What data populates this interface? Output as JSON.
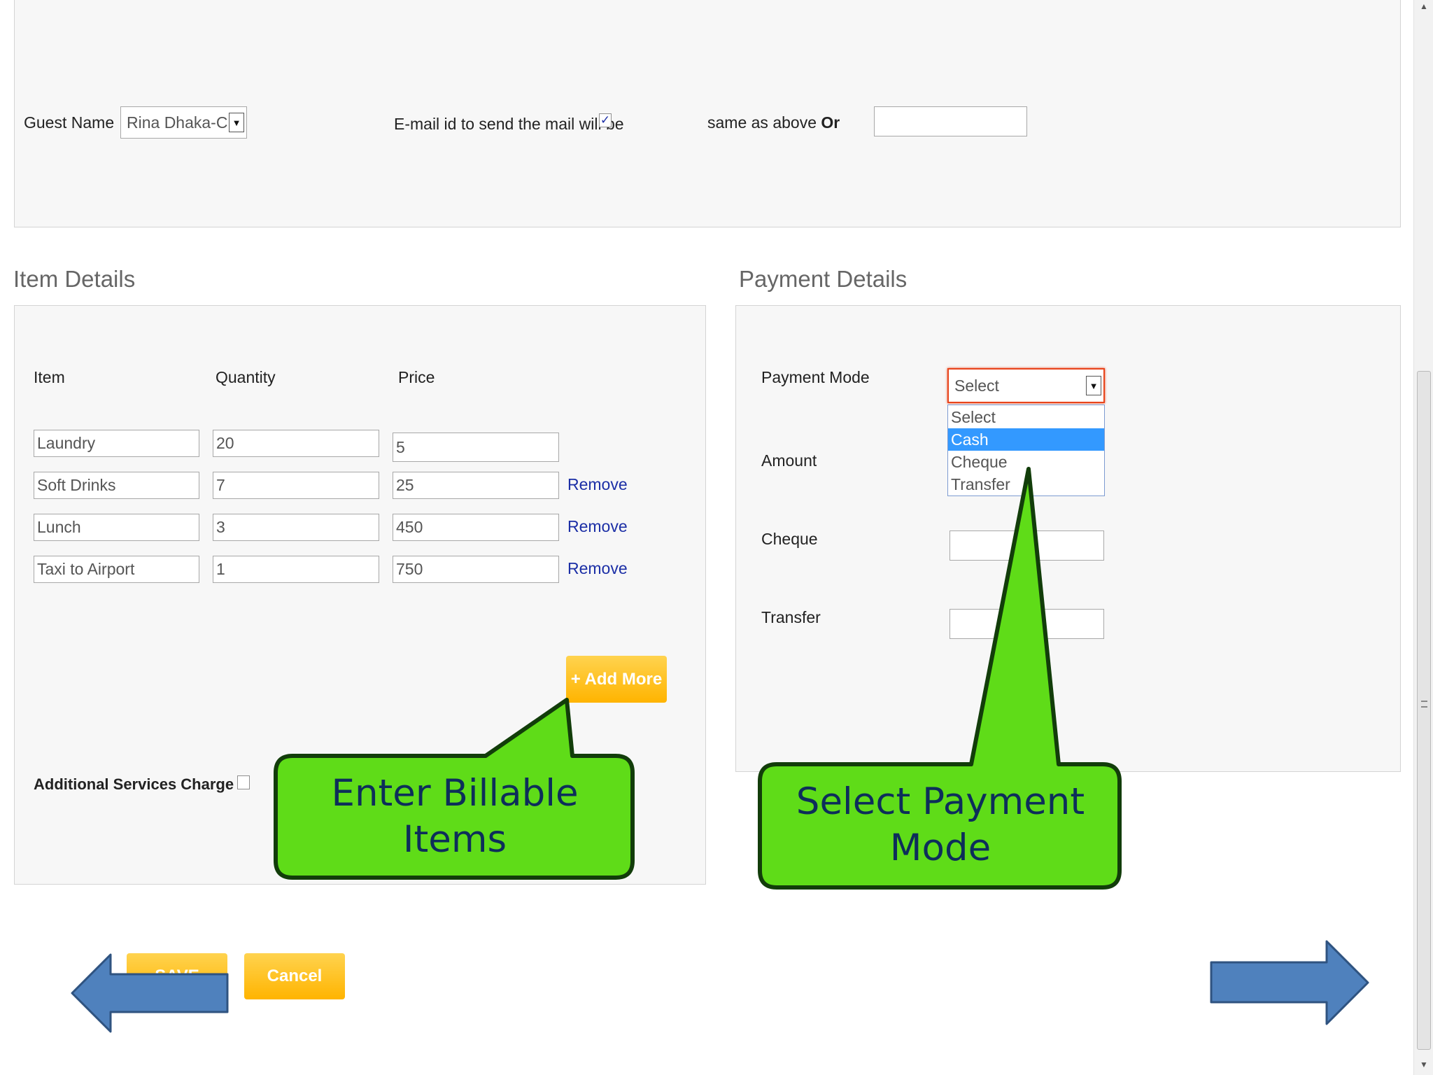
{
  "guest": {
    "name_label": "Guest Name",
    "name_value": "Rina Dhaka-CLI",
    "email_label": "E-mail id to send the mail will be",
    "email_checked": "✓",
    "same_as_above_prefix": "same as above ",
    "same_as_above_or": "Or",
    "other_email_value": ""
  },
  "items_section": {
    "title": "Item Details",
    "headers": {
      "item": "Item",
      "quantity": "Quantity",
      "price": "Price"
    },
    "rows": [
      {
        "item": "Laundry",
        "quantity": "20",
        "price": "5",
        "remove": ""
      },
      {
        "item": "Soft Drinks",
        "quantity": "7",
        "price": "25",
        "remove": "Remove"
      },
      {
        "item": "Lunch",
        "quantity": "3",
        "price": "450",
        "remove": "Remove"
      },
      {
        "item": "Taxi to Airport",
        "quantity": "1",
        "price": "750",
        "remove": "Remove"
      }
    ],
    "add_more_label": "+ Add More",
    "additional_services_label": "Additional Services Charge"
  },
  "payment_section": {
    "title": "Payment Details",
    "payment_mode_label": "Payment Mode",
    "payment_mode_selected": "Select",
    "options": [
      "Select",
      "Cash",
      "Cheque",
      "Transfer"
    ],
    "highlighted_option": "Cash",
    "amount_label": "Amount",
    "cheque_label": "Cheque",
    "transfer_label": "Transfer"
  },
  "buttons": {
    "save_label": "SAVE",
    "cancel_label": "Cancel"
  },
  "callouts": {
    "items_line1": "Enter Billable",
    "items_line2": "Items",
    "payment_line1": "Select Payment",
    "payment_line2": "Mode"
  },
  "colors": {
    "callout_green": "#5fdc18",
    "nav_arrow_blue": "#4f81bd",
    "button_orange": "#ffb400",
    "link_blue": "#1c2fa6",
    "highlight_blue": "#3399ff"
  }
}
